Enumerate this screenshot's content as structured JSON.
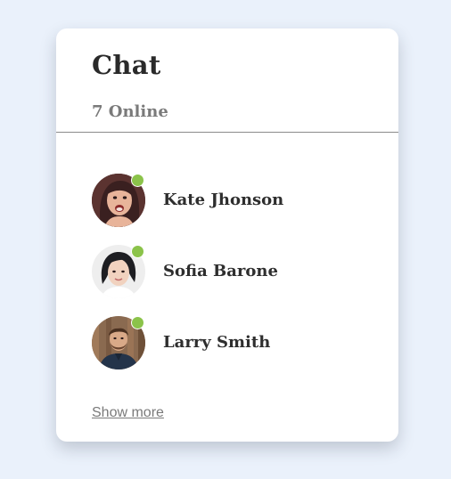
{
  "chat": {
    "title": "Chat",
    "online_label": "7 Online",
    "show_more_label": "Show more"
  },
  "colors": {
    "background": "#eaf1fb",
    "card": "#ffffff",
    "online_status": "#8bc34a",
    "divider": "#8a8a8a"
  },
  "users": [
    {
      "name": "Kate Jhonson",
      "status": "online",
      "avatar_icon": "woman-avatar-icon"
    },
    {
      "name": "Sofia Barone",
      "status": "online",
      "avatar_icon": "woman-avatar-icon"
    },
    {
      "name": "Larry Smith",
      "status": "online",
      "avatar_icon": "man-avatar-icon"
    }
  ]
}
